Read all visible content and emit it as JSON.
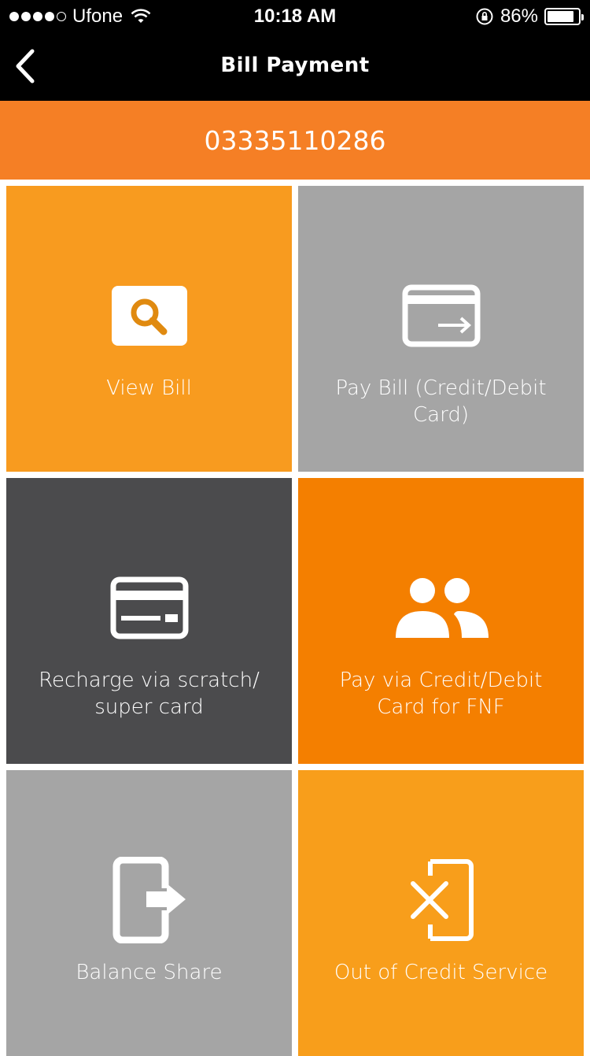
{
  "status_bar": {
    "carrier": "Ufone",
    "time": "10:18 AM",
    "battery": "86%",
    "battery_level": 0.86
  },
  "nav": {
    "title": "Bill Payment",
    "back_icon": "chevron-left-icon"
  },
  "account": {
    "number": "03335110286"
  },
  "colors": {
    "orange_bar": "#f57f25",
    "tile_orange": "#f89b1f",
    "tile_gray": "#a5a5a5",
    "tile_dark": "#4b4b4d",
    "tile_deep_orange": "#f47f00"
  },
  "tiles": [
    {
      "label": "View Bill",
      "icon": "search-icon"
    },
    {
      "label": "Pay Bill (Credit/Debit Card)",
      "icon": "card-transfer-icon"
    },
    {
      "label": "Recharge via scratch/ super card",
      "icon": "credit-card-icon"
    },
    {
      "label": "Pay via Credit/Debit Card for FNF",
      "icon": "users-icon"
    },
    {
      "label": "Balance Share",
      "icon": "phone-share-icon"
    },
    {
      "label": "Out of Credit Service",
      "icon": "phone-cancel-icon"
    }
  ]
}
